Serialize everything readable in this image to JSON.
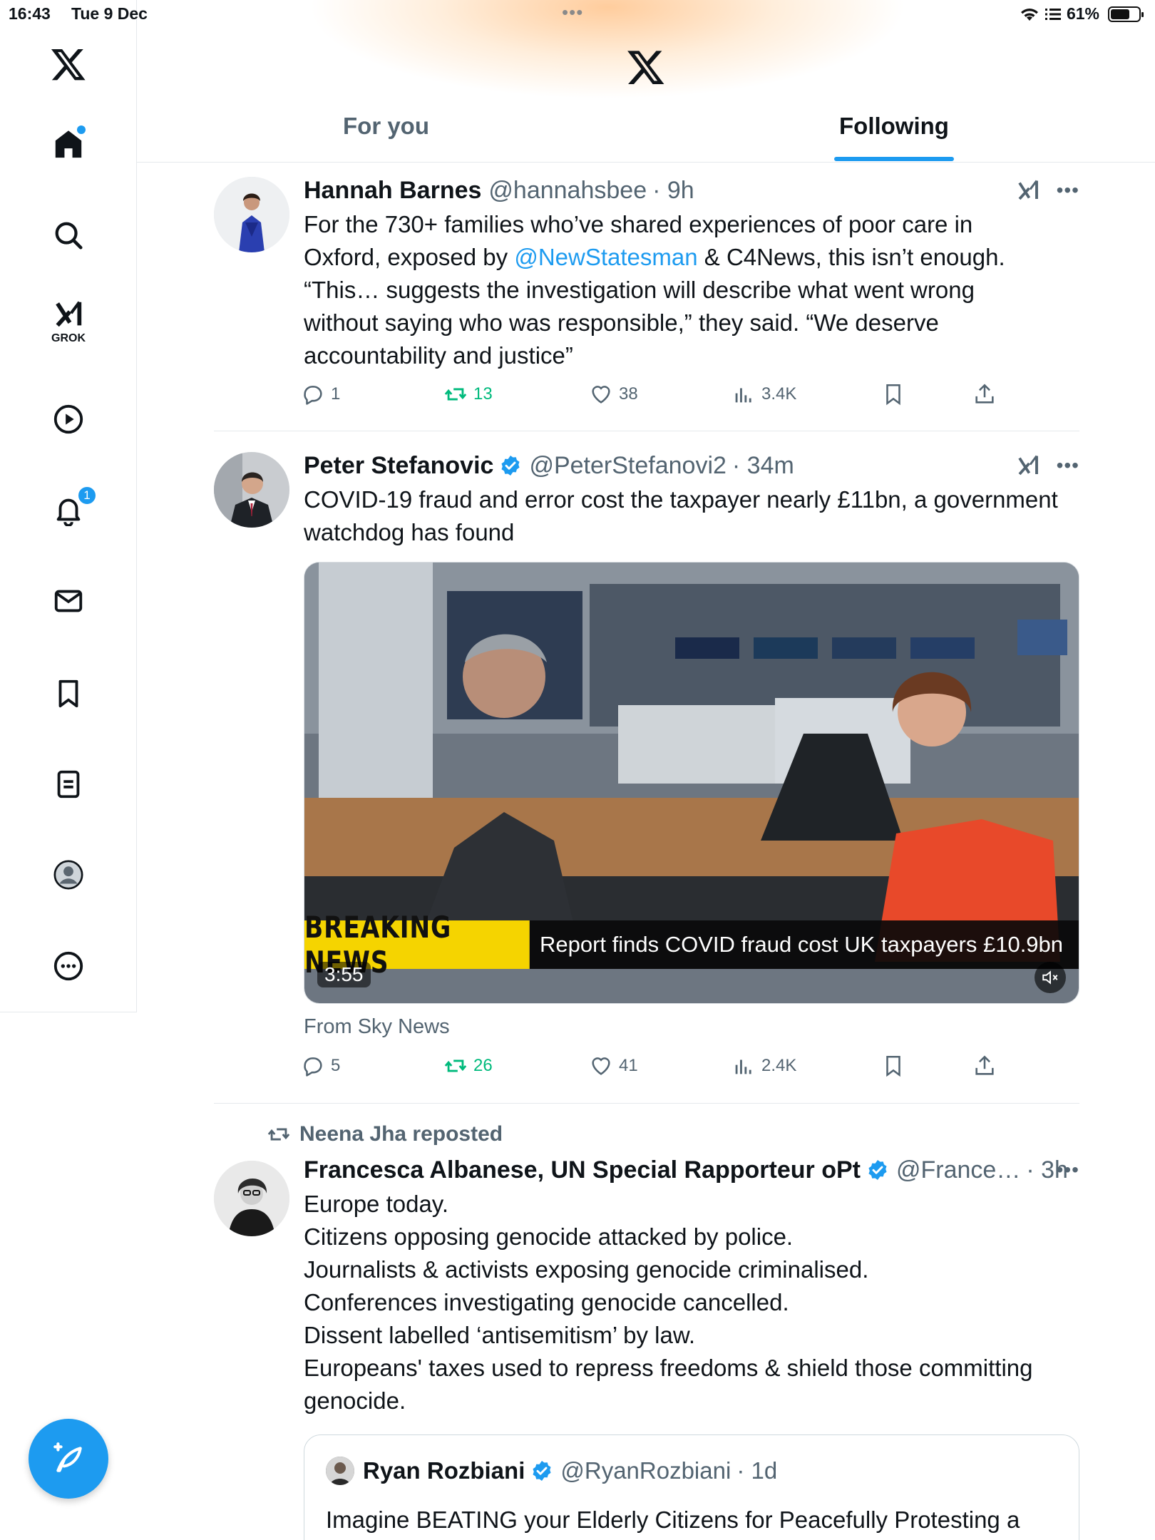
{
  "status_bar": {
    "time": "16:43",
    "date": "Tue 9 Dec",
    "battery": "61%"
  },
  "header": {
    "tabs": [
      {
        "label": "For you",
        "selected": false
      },
      {
        "label": "Following",
        "selected": true
      }
    ]
  },
  "sidebar": {
    "items": [
      {
        "name": "home",
        "icon": "home-icon",
        "active": true
      },
      {
        "name": "search",
        "icon": "search-icon"
      },
      {
        "name": "grok",
        "icon": "grok-icon",
        "label": "GROK"
      },
      {
        "name": "video",
        "icon": "play-icon"
      },
      {
        "name": "notifications",
        "icon": "bell-icon",
        "badge": "1"
      },
      {
        "name": "messages",
        "icon": "mail-icon"
      },
      {
        "name": "bookmarks",
        "icon": "bookmark-icon"
      },
      {
        "name": "lists",
        "icon": "list-icon"
      },
      {
        "name": "profile",
        "icon": "profile-icon"
      },
      {
        "name": "more",
        "icon": "more-icon"
      }
    ]
  },
  "posts": [
    {
      "author": "Hannah Barnes",
      "handle": "@hannahsbee",
      "time": "· 9h",
      "verified": false,
      "text_lines": [
        "For the 730+ families who’ve shared experiences of poor care in",
        "Oxford, exposed by ",
        "“This… suggests the investigation will describe what went wrong",
        "without saying who was responsible,” they said. “We deserve",
        "accountability and justice”"
      ],
      "mention": "@NewStatesman",
      "text_after_mention": " & C4News, this isn’t enough.",
      "counts": {
        "replies": "1",
        "reposts": "13",
        "likes": "38",
        "views": "3.4K"
      }
    },
    {
      "author": "Peter Stefanovic",
      "handle": "@PeterStefanovi2",
      "time": "· 34m",
      "verified": true,
      "text_lines": [
        "COVID-19 fraud and error cost the taxpayer nearly £11bn, a government",
        "watchdog has found"
      ],
      "media": {
        "banner": "BREAKING NEWS",
        "ticker": "Report finds COVID fraud cost UK taxpayers £10.9bn",
        "duration": "3:55"
      },
      "source": "From Sky News",
      "counts": {
        "replies": "5",
        "reposts": "26",
        "likes": "41",
        "views": "2.4K"
      }
    },
    {
      "repost_by": "Neena Jha reposted",
      "author": "Francesca Albanese, UN Special Rapporteur oPt",
      "handle": "@France…",
      "time": "· 3h",
      "verified": true,
      "text_lines": [
        "Europe today.",
        "Citizens opposing genocide attacked by police.",
        "Journalists & activists exposing genocide criminalised.",
        "Conferences investigating genocide cancelled.",
        "Dissent labelled ‘antisemitism’ by law.",
        "Europeans' taxes used to repress freedoms & shield those committing",
        "genocide."
      ],
      "quote": {
        "author": "Ryan Rozbiani",
        "handle": "@RyanRozbiani",
        "time": "· 1d",
        "verified": true,
        "text": "Imagine BEATING your Elderly Citizens for Peacefully Protesting a"
      }
    }
  ],
  "colors": {
    "accent": "#1d9bf0",
    "repost_green": "#00ba7c",
    "secondary_text": "#536471",
    "breaking_yellow": "#f5d400"
  }
}
